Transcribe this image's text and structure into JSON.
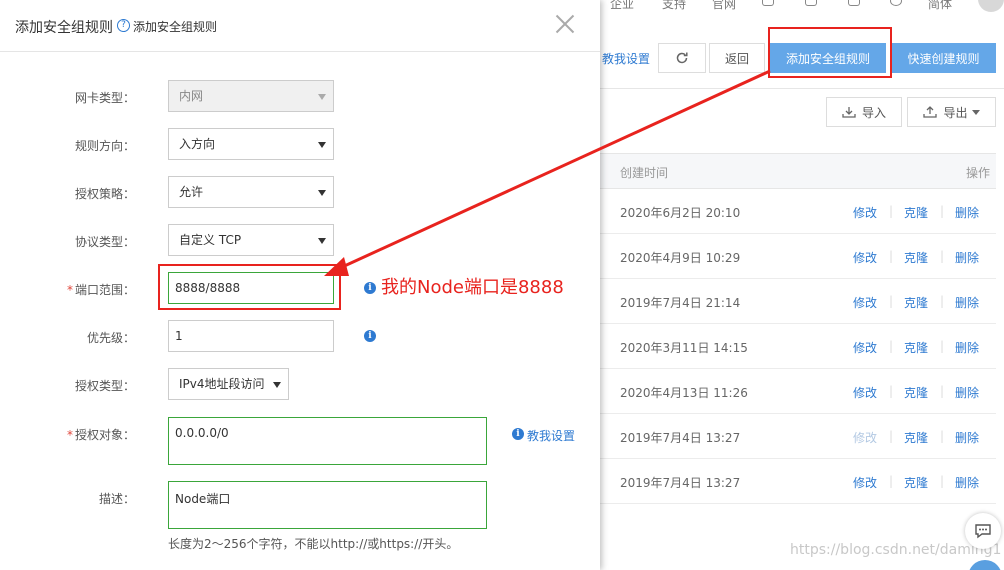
{
  "topnav": {
    "items": [
      "企业",
      "支持",
      "官网",
      "简体"
    ]
  },
  "toolbar": {
    "teach_link": "教我设置",
    "back": "返回",
    "add_rule": "添加安全组规则",
    "quick_create": "快速创建规则",
    "import": "导入",
    "export": "导出"
  },
  "table": {
    "headers": {
      "created": "创建时间",
      "actions": "操作"
    },
    "rows": [
      {
        "time": "2020年6月2日 20:10",
        "edit_enabled": true
      },
      {
        "time": "2020年4月9日 10:29",
        "edit_enabled": true
      },
      {
        "time": "2019年7月4日 21:14",
        "edit_enabled": true
      },
      {
        "time": "2020年3月11日 14:15",
        "edit_enabled": true
      },
      {
        "time": "2020年4月13日 11:26",
        "edit_enabled": true
      },
      {
        "time": "2019年7月4日 13:27",
        "edit_enabled": false
      },
      {
        "time": "2019年7月4日 13:27",
        "edit_enabled": true
      }
    ],
    "action_labels": {
      "edit": "修改",
      "clone": "克隆",
      "delete": "删除"
    }
  },
  "watermark": "https://blog.csdn.net/daming1",
  "dialog": {
    "title": "添加安全组规则",
    "help_link": "添加安全组规则",
    "help_icon": "?",
    "fields": {
      "nic_type": {
        "label": "网卡类型：",
        "value": "内网"
      },
      "direction": {
        "label": "规则方向：",
        "value": "入方向"
      },
      "policy": {
        "label": "授权策略：",
        "value": "允许"
      },
      "protocol": {
        "label": "协议类型：",
        "value": "自定义 TCP"
      },
      "port_range": {
        "label": "端口范围：",
        "value": "8888/8888",
        "required": "*"
      },
      "priority": {
        "label": "优先级：",
        "value": "1"
      },
      "auth_type": {
        "label": "授权类型：",
        "value": "IPv4地址段访问"
      },
      "auth_object": {
        "label": "授权对象：",
        "value": "0.0.0.0/0",
        "required": "*"
      },
      "description": {
        "label": "描述：",
        "value": "Node端口"
      }
    },
    "hint": "长度为2～256个字符，不能以http://或https://开头。",
    "teach_link": "教我设置",
    "info_glyph": "i"
  },
  "annotation": {
    "text": "我的Node端口是8888",
    "color": "#e8231e"
  }
}
